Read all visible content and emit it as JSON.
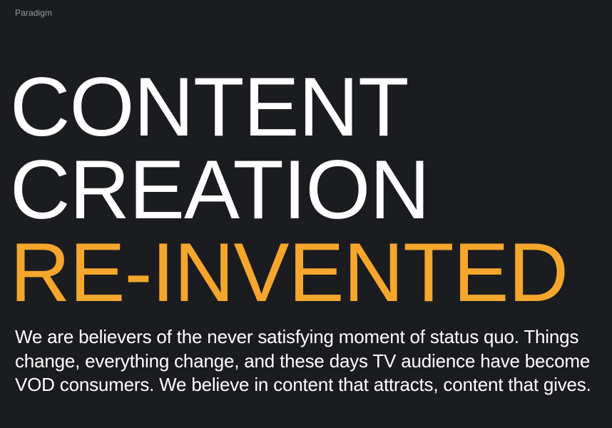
{
  "brand": {
    "name": "Paradigm"
  },
  "hero": {
    "line1": "CONTENT",
    "line2": "CREATION",
    "line3": "RE-INVENTED",
    "accent_color": "#f4a62d",
    "text_color": "#ffffff",
    "background_color": "#1b1c1f"
  },
  "intro": {
    "text": "We are believers of the never satisfying moment of status quo. Things change, everything change, and these days TV audience have become VOD consumers. We believe in content that attracts, content that gives."
  }
}
